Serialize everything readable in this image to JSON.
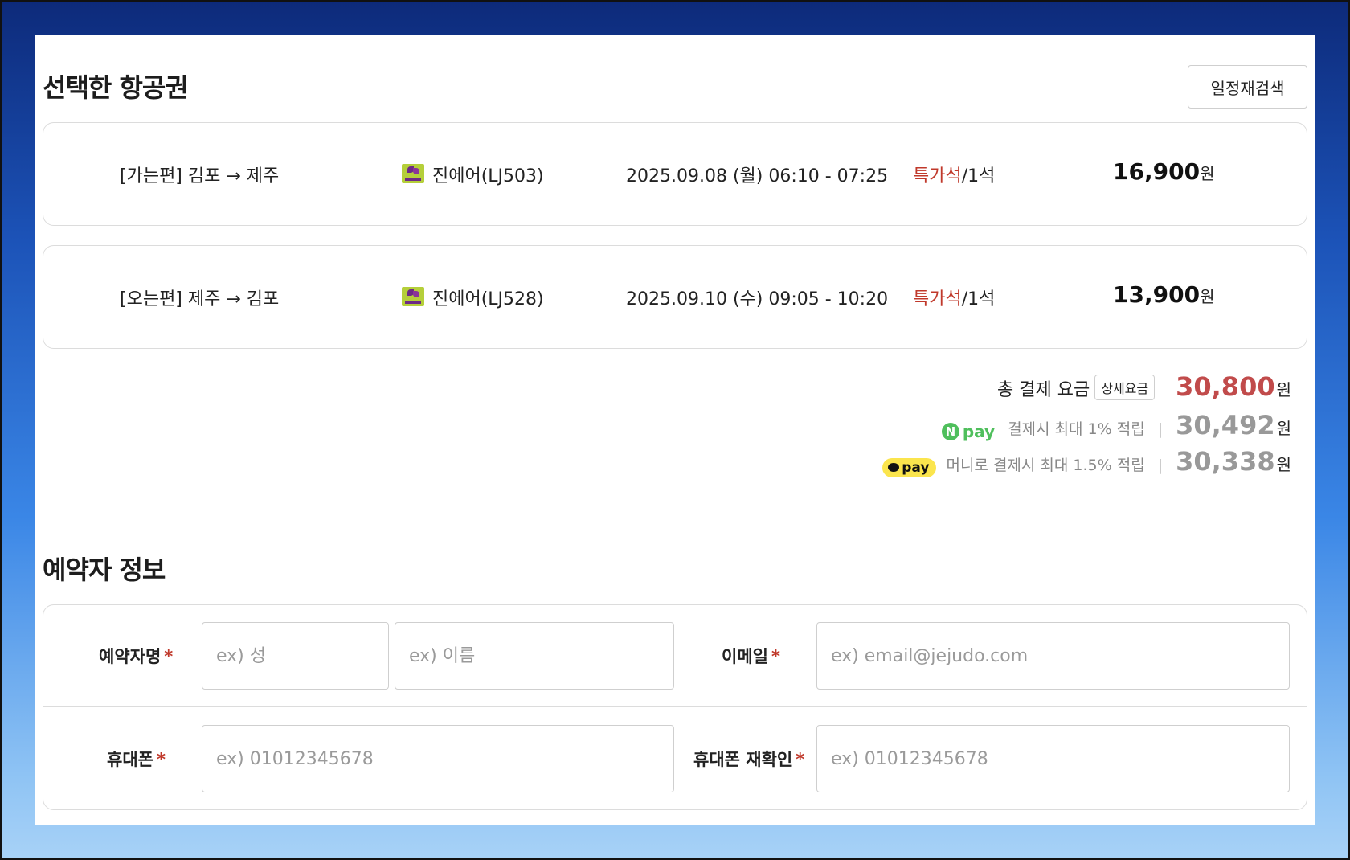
{
  "selected_flights": {
    "title": "선택한 항공권",
    "research_button": "일정재검색",
    "flights": [
      {
        "route": "[가는편] 김포 → 제주",
        "airline": "진에어(LJ503)",
        "datetime": "2025.09.08 (월) 06:10 - 07:25",
        "seat_class": "특가석",
        "seat_count": "/1석",
        "price": "16,900",
        "currency": "원"
      },
      {
        "route": "[오는편] 제주 → 김포",
        "airline": "진에어(LJ528)",
        "datetime": "2025.09.10 (수) 09:05 - 10:20",
        "seat_class": "특가석",
        "seat_count": "/1석",
        "price": "13,900",
        "currency": "원"
      }
    ]
  },
  "payment_summary": {
    "total_label": "총 결제 요금",
    "detail_button": "상세요금",
    "total_value": "30,800",
    "currency": "원",
    "npay": {
      "logo_letter": "N",
      "logo_text": "pay",
      "description": "결제시 최대 1% 적립",
      "separator": "|",
      "value": "30,492",
      "currency": "원"
    },
    "kakaopay": {
      "logo_text": "pay",
      "description": "머니로 결제시 최대 1.5% 적립",
      "separator": "|",
      "value": "30,338",
      "currency": "원"
    }
  },
  "booker_info": {
    "title": "예약자 정보",
    "required_mark": "*",
    "name_label": "예약자명",
    "last_name_placeholder": "ex) 성",
    "first_name_placeholder": "ex) 이름",
    "email_label": "이메일",
    "email_placeholder": "ex) email@jejudo.com",
    "phone_label": "휴대폰",
    "phone_placeholder": "ex) 01012345678",
    "phone_confirm_label": "휴대폰 재확인",
    "phone_confirm_placeholder": "ex) 01012345678"
  },
  "colors": {
    "accent_red": "#c14b4b",
    "npay_green": "#4fbf5c",
    "kakao_yellow": "#fbe54d"
  }
}
